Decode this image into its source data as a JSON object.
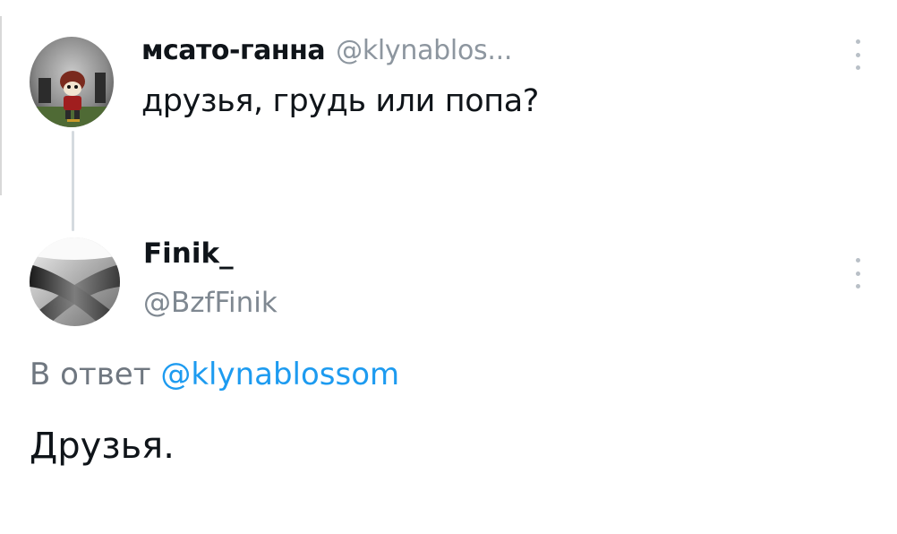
{
  "colors": {
    "text": "#0f1419",
    "secondary": "#7f8891",
    "accent": "#1d9bf0",
    "thread_line": "#d5dadf"
  },
  "original_tweet": {
    "avatar": "user-avatar",
    "display_name": "мсато-ганна",
    "handle": "@klynablos...",
    "text": "друзья, грудь или попа?",
    "more_icon": "more-vertical-icon"
  },
  "reply_tweet": {
    "avatar": "user-avatar",
    "display_name": "Finik_",
    "handle": "@BzfFinik",
    "reply_prefix": "В ответ",
    "reply_to_handle": "@klynablossom",
    "text": "Друзья.",
    "more_icon": "more-vertical-icon"
  }
}
